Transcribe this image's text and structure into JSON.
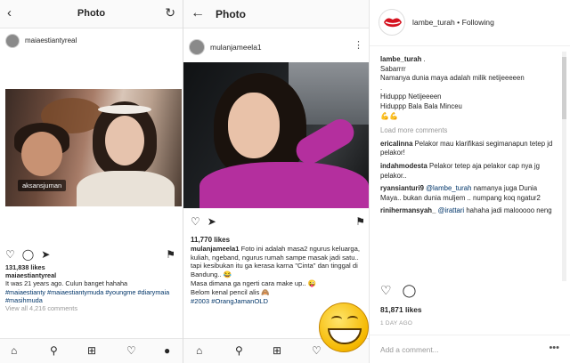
{
  "panel1": {
    "title": "Photo",
    "username": "maiaestiantyreal",
    "photo_tag": "aksansjuman",
    "likes": "131,838 likes",
    "caption_user": "maiaestiantyreal",
    "caption_text": "It was 21 years ago. Culun banget hahaha",
    "hashtags": "#maiaestianty #maiaestiantymuda #youngme #diarymaia #masihmuda",
    "view_comments": "View all 4,216 comments"
  },
  "panel2": {
    "title": "Photo",
    "username": "mulanjameela1",
    "likes": "11,770 likes",
    "caption_user": "mulanjameela1",
    "caption_text": "Foto ini adalah masa2 ngurus keluarga, kuliah, ngeband, ngurus rumah sampe masak jadi satu.. tapi kesibukan itu ga kerasa karna \"Cinta\" dan tinggal di Bandung..",
    "caption_emoji1": "😂",
    "line2": "Masa dimana ga ngerti cara make up..",
    "line2_emoji": "😜",
    "line3": "Belom kenal pencil alis",
    "line3_emoji": "🙈",
    "hashtags": "#2003 #OrangJamanOLD"
  },
  "panel3": {
    "account": "lambe_turah",
    "following": "• Following",
    "caption_user": "lambe_turah",
    "caption_lines": [
      ".",
      "Sabarrrr",
      "Namanya dunia maya adalah milik netijeeeeen",
      ".",
      "Hiduppp Netijeeeen",
      "Hiduppp Bala Bala Minceu"
    ],
    "caption_emoji": "💪💪",
    "load_more": "Load more comments",
    "comments": [
      {
        "user": "ericalinna",
        "text": "Pelakor mau klarifikasi segimanapun tetep jd pelakor!"
      },
      {
        "user": "indahmodesta",
        "text": "Pelakor tetep aja pelakor cap nya jg pelakor.."
      },
      {
        "user": "ryansianturi9",
        "mention": "@lambe_turah",
        "text": "namanya juga Dunia Maya.. bukan dunia muljem .. numpang koq ngatur2"
      },
      {
        "user": "rinihermansyah_",
        "mention": "@irattari",
        "text": "hahaha jadi malooooo neng"
      }
    ],
    "likes": "81,871 likes",
    "date": "1 DAY AGO",
    "add_comment_placeholder": "Add a comment...",
    "more": "•••"
  },
  "colors": {
    "link": "#003569",
    "brand_lips": "#d5121f",
    "hashtag": "#003569"
  }
}
